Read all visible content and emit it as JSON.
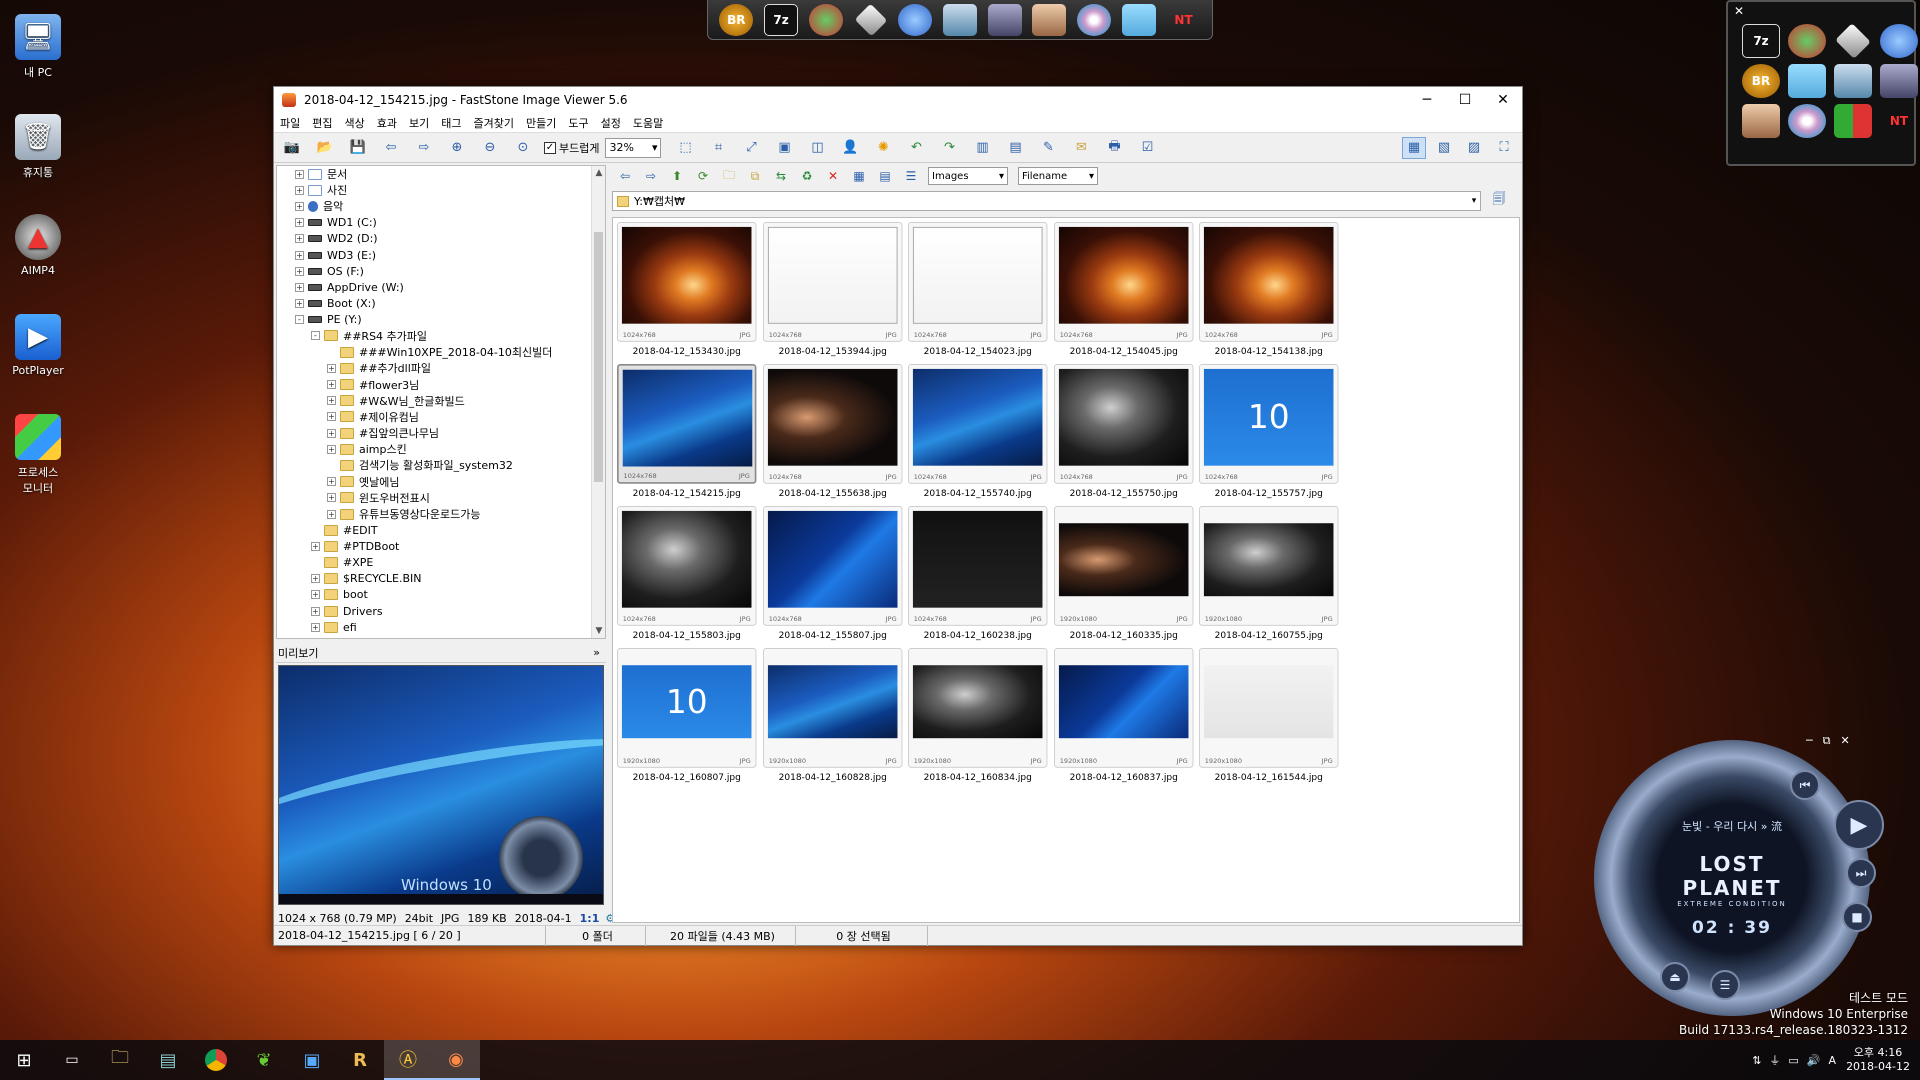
{
  "desktop": {
    "icons": [
      {
        "label": "내 PC",
        "icon": "pc-icon"
      },
      {
        "label": "휴지통",
        "icon": "recycle-bin-icon"
      },
      {
        "label": "AIMP4",
        "icon": "aimp-icon"
      },
      {
        "label": "PotPlayer",
        "icon": "potplayer-icon"
      },
      {
        "label": "프로세스\n모니터",
        "icon": "process-monitor-icon"
      }
    ]
  },
  "top_dock": {
    "items": [
      "BR",
      "7z",
      "",
      "",
      "",
      "",
      "",
      "",
      "",
      "",
      "NT"
    ]
  },
  "window": {
    "title": "2018-04-12_154215.jpg  -  FastStone Image Viewer 5.6",
    "menu": [
      "파일",
      "편집",
      "색상",
      "효과",
      "보기",
      "태그",
      "즐겨찾기",
      "만들기",
      "도구",
      "설정",
      "도움말"
    ],
    "toolbar": {
      "smooth_label": "부드럽게",
      "smooth_checked": true,
      "zoom_value": "32%"
    },
    "filter": {
      "type_value": "Images",
      "sort_value": "Filename"
    },
    "path": "Y:₩캡처₩",
    "tree": [
      {
        "label": "문서",
        "level": 1,
        "exp": "+",
        "icon": "doc"
      },
      {
        "label": "사진",
        "level": 1,
        "exp": "+",
        "icon": "doc"
      },
      {
        "label": "음악",
        "level": 1,
        "exp": "+",
        "icon": "music"
      },
      {
        "label": "WD1 (C:)",
        "level": 1,
        "exp": "+",
        "icon": "drive"
      },
      {
        "label": "WD2 (D:)",
        "level": 1,
        "exp": "+",
        "icon": "drive"
      },
      {
        "label": "WD3 (E:)",
        "level": 1,
        "exp": "+",
        "icon": "drive"
      },
      {
        "label": "OS (F:)",
        "level": 1,
        "exp": "+",
        "icon": "drive"
      },
      {
        "label": "AppDrive (W:)",
        "level": 1,
        "exp": "+",
        "icon": "drive"
      },
      {
        "label": "Boot (X:)",
        "level": 1,
        "exp": "+",
        "icon": "drive"
      },
      {
        "label": "PE (Y:)",
        "level": 1,
        "exp": "-",
        "icon": "drive"
      },
      {
        "label": "##RS4 추가파일",
        "level": 2,
        "exp": "-",
        "icon": "folder"
      },
      {
        "label": "###Win10XPE_2018-04-10최신빌더",
        "level": 3,
        "exp": "",
        "icon": "folder"
      },
      {
        "label": "##추가dll파일",
        "level": 3,
        "exp": "+",
        "icon": "folder"
      },
      {
        "label": "#flower3님",
        "level": 3,
        "exp": "+",
        "icon": "folder"
      },
      {
        "label": "#W&W님_한글화빌드",
        "level": 3,
        "exp": "+",
        "icon": "folder"
      },
      {
        "label": "#제이유컴님",
        "level": 3,
        "exp": "+",
        "icon": "folder"
      },
      {
        "label": "#집앞의큰나무님",
        "level": 3,
        "exp": "+",
        "icon": "folder"
      },
      {
        "label": "aimp스킨",
        "level": 3,
        "exp": "+",
        "icon": "folder"
      },
      {
        "label": "검색기능 활성화파일_system32",
        "level": 3,
        "exp": "",
        "icon": "folder"
      },
      {
        "label": "옛날에님",
        "level": 3,
        "exp": "+",
        "icon": "folder"
      },
      {
        "label": "윈도우버전표시",
        "level": 3,
        "exp": "+",
        "icon": "folder"
      },
      {
        "label": "유튜브동영상다운로드가능",
        "level": 3,
        "exp": "+",
        "icon": "folder"
      },
      {
        "label": "#EDIT",
        "level": 2,
        "exp": "",
        "icon": "folder"
      },
      {
        "label": "#PTDBoot",
        "level": 2,
        "exp": "+",
        "icon": "folder"
      },
      {
        "label": "#XPE",
        "level": 2,
        "exp": "",
        "icon": "folder"
      },
      {
        "label": "$RECYCLE.BIN",
        "level": 2,
        "exp": "+",
        "icon": "folder"
      },
      {
        "label": "boot",
        "level": 2,
        "exp": "+",
        "icon": "folder"
      },
      {
        "label": "Drivers",
        "level": 2,
        "exp": "+",
        "icon": "folder"
      },
      {
        "label": "efi",
        "level": 2,
        "exp": "+",
        "icon": "folder"
      }
    ],
    "preview": {
      "header": "미리보기",
      "win_text": "Windows 10",
      "logo_text": "LOST PLANET"
    },
    "preview_info": {
      "dimensions": "1024 x 768 (0.79 MP)",
      "bitdepth": "24bit",
      "format": "JPG",
      "size": "189 KB",
      "date": "2018-04-1",
      "ratio": "1:1"
    },
    "thumbnails": [
      {
        "name": "2018-04-12_153430.jpg",
        "dims": "1024x768",
        "ext": "JPG",
        "style": "tunnel"
      },
      {
        "name": "2018-04-12_153944.jpg",
        "dims": "1024x768",
        "ext": "JPG",
        "style": "doc"
      },
      {
        "name": "2018-04-12_154023.jpg",
        "dims": "1024x768",
        "ext": "JPG",
        "style": "doc"
      },
      {
        "name": "2018-04-12_154045.jpg",
        "dims": "1024x768",
        "ext": "JPG",
        "style": "tunnel"
      },
      {
        "name": "2018-04-12_154138.jpg",
        "dims": "1024x768",
        "ext": "JPG",
        "style": "tunnel"
      },
      {
        "name": "2018-04-12_154215.jpg",
        "dims": "1024x768",
        "ext": "JPG",
        "style": "blue",
        "selected": true
      },
      {
        "name": "2018-04-12_155638.jpg",
        "dims": "1024x768",
        "ext": "JPG",
        "style": "photo"
      },
      {
        "name": "2018-04-12_155740.jpg",
        "dims": "1024x768",
        "ext": "JPG",
        "style": "blue"
      },
      {
        "name": "2018-04-12_155750.jpg",
        "dims": "1024x768",
        "ext": "JPG",
        "style": "bw"
      },
      {
        "name": "2018-04-12_155757.jpg",
        "dims": "1024x768",
        "ext": "JPG",
        "style": "ten"
      },
      {
        "name": "2018-04-12_155803.jpg",
        "dims": "1024x768",
        "ext": "JPG",
        "style": "bw"
      },
      {
        "name": "2018-04-12_155807.jpg",
        "dims": "1024x768",
        "ext": "JPG",
        "style": "win"
      },
      {
        "name": "2018-04-12_160238.jpg",
        "dims": "1024x768",
        "ext": "JPG",
        "style": "dark"
      },
      {
        "name": "2018-04-12_160335.jpg",
        "dims": "1920x1080",
        "ext": "JPG",
        "style": "photo",
        "wide": true
      },
      {
        "name": "2018-04-12_160755.jpg",
        "dims": "1920x1080",
        "ext": "JPG",
        "style": "bw",
        "wide": true
      },
      {
        "name": "2018-04-12_160807.jpg",
        "dims": "1920x1080",
        "ext": "JPG",
        "style": "ten",
        "wide": true
      },
      {
        "name": "2018-04-12_160828.jpg",
        "dims": "1920x1080",
        "ext": "JPG",
        "style": "blue",
        "wide": true
      },
      {
        "name": "2018-04-12_160834.jpg",
        "dims": "1920x1080",
        "ext": "JPG",
        "style": "bw",
        "wide": true
      },
      {
        "name": "2018-04-12_160837.jpg",
        "dims": "1920x1080",
        "ext": "JPG",
        "style": "win",
        "wide": true
      },
      {
        "name": "2018-04-12_161544.jpg",
        "dims": "1920x1080",
        "ext": "JPG",
        "style": "collage",
        "wide": true
      }
    ],
    "ten_text": "10",
    "status": {
      "file": "2018-04-12_154215.jpg [ 6 / 20 ]",
      "folders": "0 폴더",
      "files": "20 파일들 (4.43 MB)",
      "selected": "0 장 선택됨"
    }
  },
  "player": {
    "song": "눈빛 - 우리 다시 » 流",
    "logo": "LOST PLANET",
    "sub": "EXTREME CONDITION",
    "time": "02 : 39"
  },
  "watermark": {
    "line1": "테스트 모드",
    "line2": "Windows 10 Enterprise",
    "line3": "Build 17133.rs4_release.180323-1312"
  },
  "tray": {
    "time": "오후 4:16",
    "date": "2018-04-12",
    "ime": "A"
  },
  "taskbar": {
    "items": [
      "start-icon",
      "terminal-icon",
      "explorer-icon",
      "notepad-icon",
      "chrome-icon",
      "leaf-app-icon",
      "control-panel-icon",
      "r-app-icon",
      "aimp-task-icon",
      "faststone-task-icon"
    ]
  },
  "colors": {
    "accent": "#2b5fa8",
    "folder": "#f3d37a",
    "selection_frame": "#8a8a8a"
  }
}
